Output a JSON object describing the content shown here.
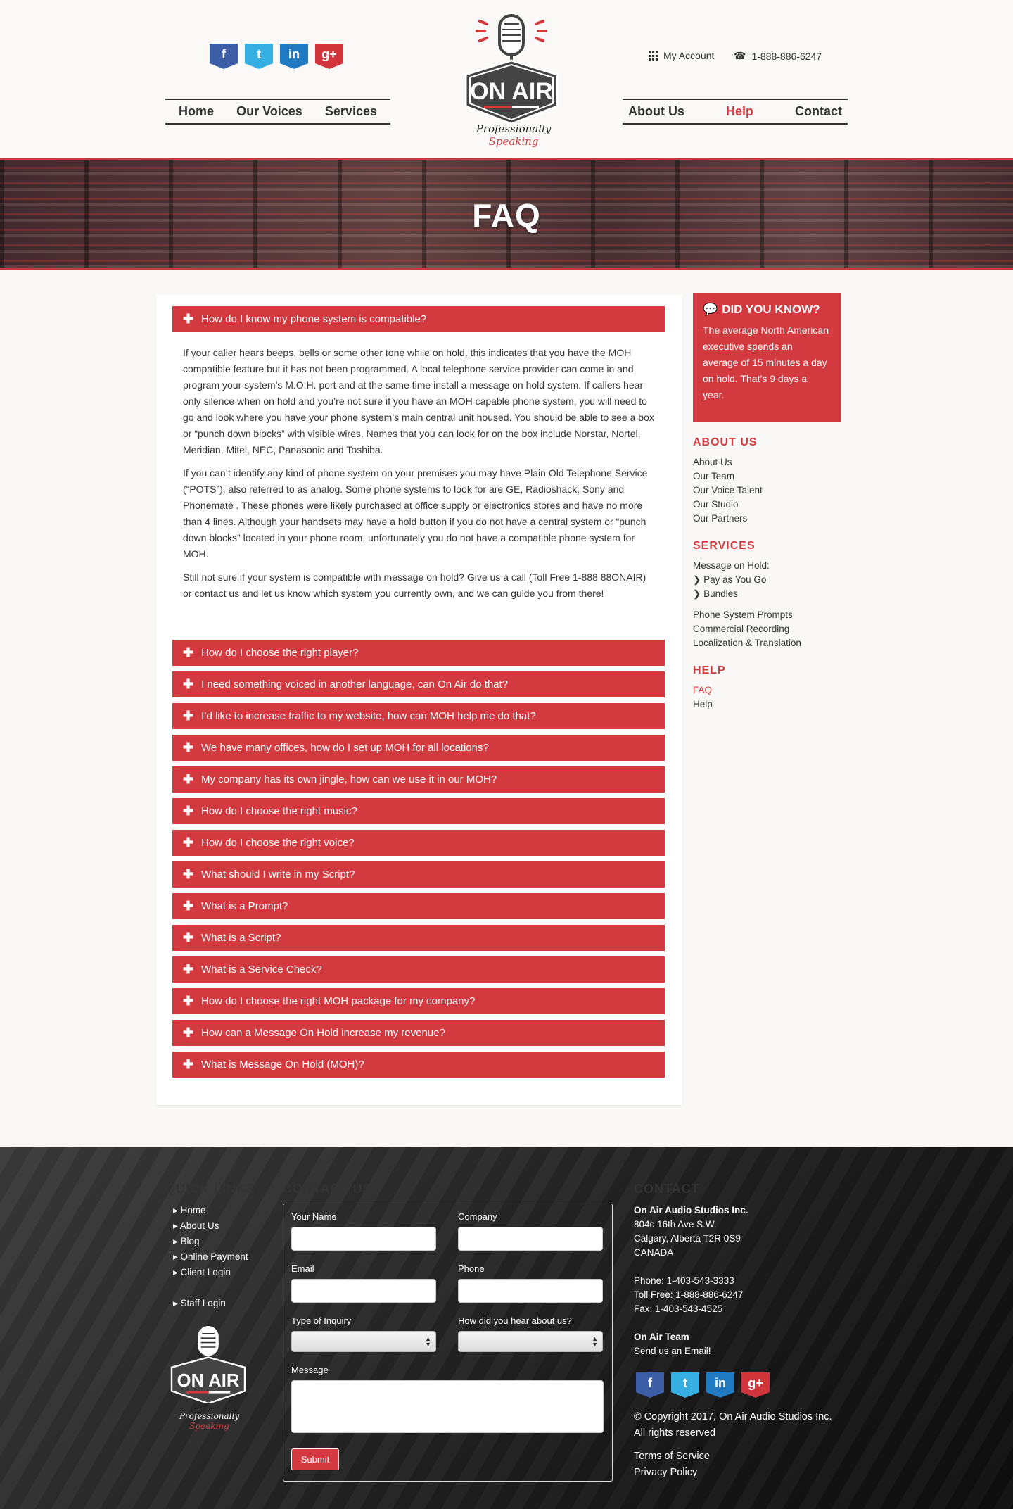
{
  "header": {
    "social": [
      {
        "icon": "facebook-icon",
        "glyph": "f"
      },
      {
        "icon": "twitter-icon",
        "glyph": "t"
      },
      {
        "icon": "linkedin-icon",
        "glyph": "in"
      },
      {
        "icon": "google-plus-icon",
        "glyph": "g+"
      }
    ],
    "nav_left": [
      "Home",
      "Our Voices",
      "Services"
    ],
    "nav_right": [
      "About Us",
      "Help",
      "Contact"
    ],
    "my_account": "My Account",
    "phone": "1-888-886-6247",
    "logo_text": "ON AIR",
    "tagline_1": "Professionally",
    "tagline_2": "Speaking"
  },
  "banner": {
    "title": "FAQ"
  },
  "faq": {
    "open_question": "How do I know my phone system is compatible?",
    "answer_paragraphs": [
      "If your caller hears beeps, bells or some other tone while on hold, this indicates that you have the MOH compatible feature but it has not been programmed. A local telephone service provider can come in and program your system’s M.O.H. port and at the same time install a message on hold system. If callers hear only silence when on hold and you’re not sure if you have an MOH capable phone system, you will need to go and look where you have your phone system’s main central unit housed. You should be able to see a box or “punch down blocks” with visible wires. Names that you can look for on the box include Norstar, Nortel, Meridian, Mitel, NEC, Panasonic and Toshiba.",
      "If you can’t identify any kind of phone system on your premises you may have Plain Old Telephone Service (“POTS”), also referred to as analog. Some phone systems to look for are GE, Radioshack, Sony and Phonemate . These phones were likely purchased at office supply or electronics stores and have no more than 4 lines. Although your handsets may have a hold button if you do not have a central system or “punch down blocks” located in your phone room, unfortunately you do not have a compatible phone system for MOH.",
      "Still not sure if your system is compatible with message on hold? Give us a call (Toll Free 1-888 88ONAIR) or contact us and let us know which system you currently own, and we can guide you from there!"
    ],
    "questions": [
      "How do I choose the right player?",
      "I need something voiced in another language, can On Air do that?",
      "I’d like to increase traffic to my website, how can MOH help me do that?",
      "We have many offices, how do I set up MOH for all locations?",
      "My company has its own jingle, how can we use it in our MOH?",
      "How do I choose the right music?",
      "How do I choose the right voice?",
      "What should I write in my Script?",
      "What is a Prompt?",
      "What is a Script?",
      "What is a Service Check?",
      "How do I choose the right MOH package for my company?",
      "How can a Message On Hold increase my revenue?",
      "What is Message On Hold (MOH)?"
    ]
  },
  "sidebar": {
    "dyk_title": "DID YOU KNOW?",
    "dyk_text": "The average North American executive spends an average of 15 minutes a day on hold. That’s 9 days a year.",
    "about_title": "ABOUT US",
    "about_links": [
      "About Us",
      "Our Team",
      "Our Voice Talent",
      "Our Studio",
      "Our Partners"
    ],
    "services_title": "SERVICES",
    "services_moh": "Message on Hold:",
    "services_sub": [
      "Pay as You Go",
      "Bundles"
    ],
    "services_links": [
      "Phone System Prompts",
      "Commercial Recording",
      "Localization & Translation"
    ],
    "help_title": "HELP",
    "help_links": [
      "FAQ",
      "Help"
    ]
  },
  "footer": {
    "quick_title": "QUICK LINKS",
    "quick_links": [
      "Home",
      "About Us",
      "Blog",
      "Online Payment",
      "Client Login"
    ],
    "staff_login": "Staff Login",
    "contact_form_title": "CONTACT US",
    "form": {
      "your_name": "Your Name",
      "company": "Company",
      "email": "Email",
      "phone": "Phone",
      "inquiry": "Type of Inquiry",
      "hear": "How did you hear about us?",
      "message": "Message",
      "submit": "Submit"
    },
    "contact_title": "CONTACT",
    "company_name": "On Air Audio Studios Inc.",
    "address_1": "804c 16th Ave S.W.",
    "address_2": "Calgary, Alberta T2R 0S9",
    "address_3": "CANADA",
    "phone": "Phone: 1-403-543-3333",
    "toll_free": "Toll Free: 1-888-886-6247",
    "fax": "Fax: 1-403-543-4525",
    "team_title": "On Air Team",
    "team_email": "Send us an Email!",
    "copyright": "© Copyright 2017, On Air Audio Studios Inc.",
    "rights": "All rights reserved",
    "terms": "Terms of Service",
    "privacy": "Privacy Policy"
  }
}
